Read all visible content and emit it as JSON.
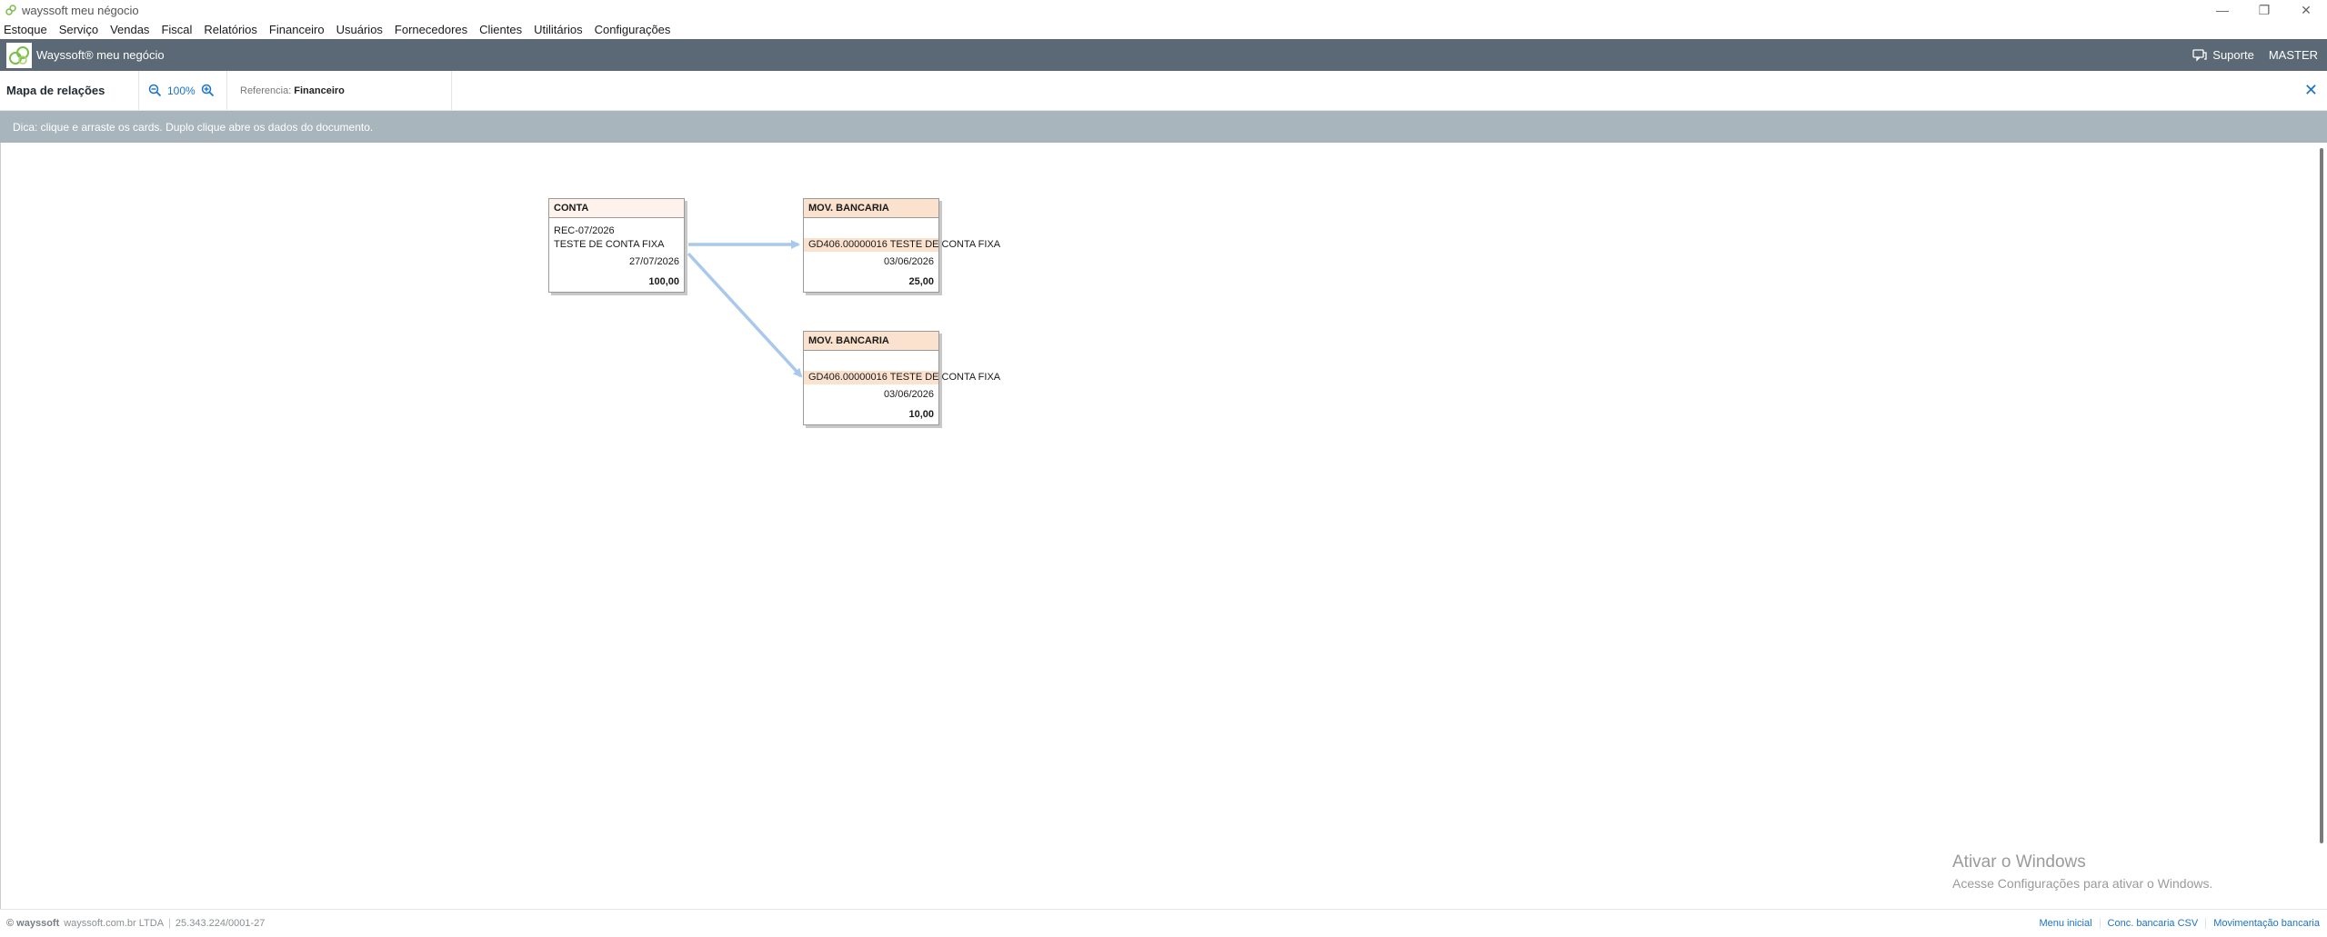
{
  "window": {
    "title": "wayssoft meu négocio",
    "controls": [
      "—",
      "❐",
      "✕"
    ]
  },
  "menu": [
    "Estoque",
    "Serviço",
    "Vendas",
    "Fiscal",
    "Relatórios",
    "Financeiro",
    "Usuários",
    "Fornecedores",
    "Clientes",
    "Utilitários",
    "Configurações"
  ],
  "appbar": {
    "app_name": "Wayssoft® meu negócio",
    "support_label": "Suporte",
    "user": "MASTER"
  },
  "toolbar": {
    "page_title": "Mapa de relações",
    "zoom_level": "100%",
    "reference_label": "Referencia:",
    "reference_value": "Financeiro",
    "close_label": "✕"
  },
  "hint": "Dica: clique e arraste os cards. Duplo clique abre os dados do documento.",
  "cards": [
    {
      "header": "CONTA",
      "doc": "REC-07/2026",
      "description": "TESTE DE CONTA FIXA",
      "date": "27/07/2026",
      "value": "100,00"
    },
    {
      "header": "MOV. BANCARIA",
      "doc": "GD406.00000016 TESTE DE CONTA FIXA",
      "date": "03/06/2026",
      "value": "25,00"
    },
    {
      "header": "MOV. BANCARIA",
      "doc": "GD406.00000016 TESTE DE CONTA FIXA",
      "date": "03/06/2026",
      "value": "10,00"
    }
  ],
  "watermark": {
    "line1": "Ativar o Windows",
    "line2": "Acesse Configurações para ativar o Windows."
  },
  "footer": {
    "brand": "© wayssoft",
    "company": "wayssoft.com.br LTDA",
    "cnpj": "25.343.224/0001-27",
    "links": [
      "Menu inicial",
      "Conc. bancaria CSV",
      "Movimentação bancaria"
    ]
  },
  "colors": {
    "appbar": "#5a6975",
    "hint_bar": "#a8b5bd",
    "accent": "#1a73c9",
    "connector": "#a9c8ee",
    "card_header_mov": "#fbe2cf"
  }
}
